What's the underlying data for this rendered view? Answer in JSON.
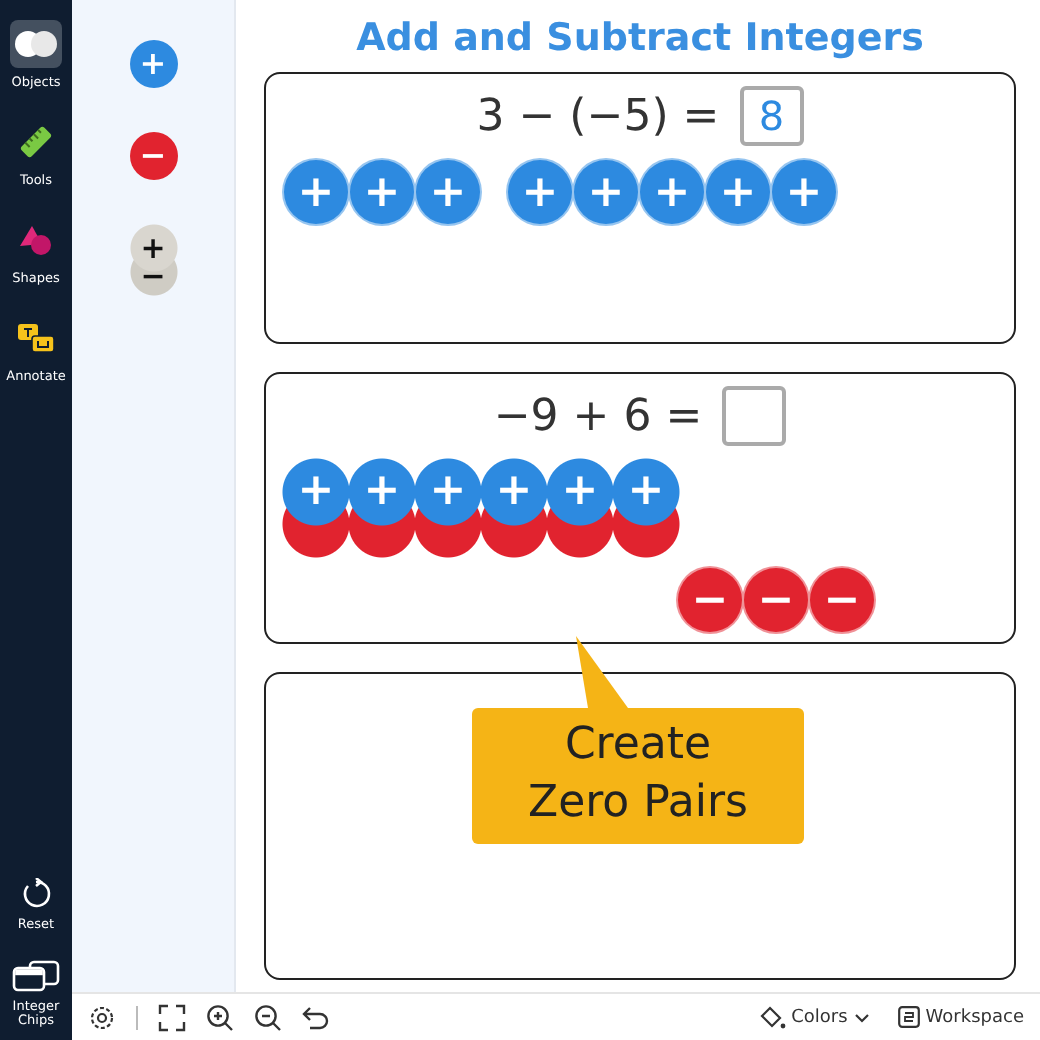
{
  "sidebar": {
    "items": [
      {
        "label": "Objects",
        "selected": true
      },
      {
        "label": "Tools",
        "selected": false
      },
      {
        "label": "Shapes",
        "selected": false
      },
      {
        "label": "Annotate",
        "selected": false
      }
    ],
    "bottom_items": [
      {
        "label": "Reset"
      },
      {
        "label": "Integer Chips"
      }
    ]
  },
  "palette": [
    {
      "kind": "positive",
      "signs": [
        "+"
      ]
    },
    {
      "kind": "negative",
      "signs": [
        "−"
      ]
    },
    {
      "kind": "pair",
      "signs": [
        "+",
        "−"
      ]
    }
  ],
  "title": "Add and Subtract Integers",
  "problems": [
    {
      "expression": "3 − (−5) =",
      "answer": "8",
      "groups": [
        {
          "kind": "row",
          "chips": [
            {
              "kind": "positive",
              "sign": "+"
            },
            {
              "kind": "positive",
              "sign": "+"
            },
            {
              "kind": "positive",
              "sign": "+"
            }
          ]
        },
        {
          "kind": "row",
          "chips": [
            {
              "kind": "positive",
              "sign": "+"
            },
            {
              "kind": "positive",
              "sign": "+"
            },
            {
              "kind": "positive",
              "sign": "+"
            },
            {
              "kind": "positive",
              "sign": "+"
            },
            {
              "kind": "positive",
              "sign": "+"
            }
          ]
        }
      ]
    },
    {
      "expression": "−9 + 6 =",
      "groups": [
        {
          "kind": "pairs",
          "chips": [
            {
              "kind": "pair",
              "sign": "+"
            },
            {
              "kind": "pair",
              "sign": "+"
            },
            {
              "kind": "pair",
              "sign": "+"
            },
            {
              "kind": "pair",
              "sign": "+"
            },
            {
              "kind": "pair",
              "sign": "+"
            },
            {
              "kind": "pair",
              "sign": "+"
            }
          ]
        },
        {
          "kind": "row",
          "chips": [
            {
              "kind": "negative",
              "sign": "−"
            },
            {
              "kind": "negative",
              "sign": "−"
            },
            {
              "kind": "negative",
              "sign": "−"
            }
          ]
        }
      ]
    }
  ],
  "callout": {
    "lines": [
      "Create",
      "Zero Pairs"
    ]
  },
  "toolbar": {
    "colors": "Colors",
    "workspace": "Workspace"
  }
}
